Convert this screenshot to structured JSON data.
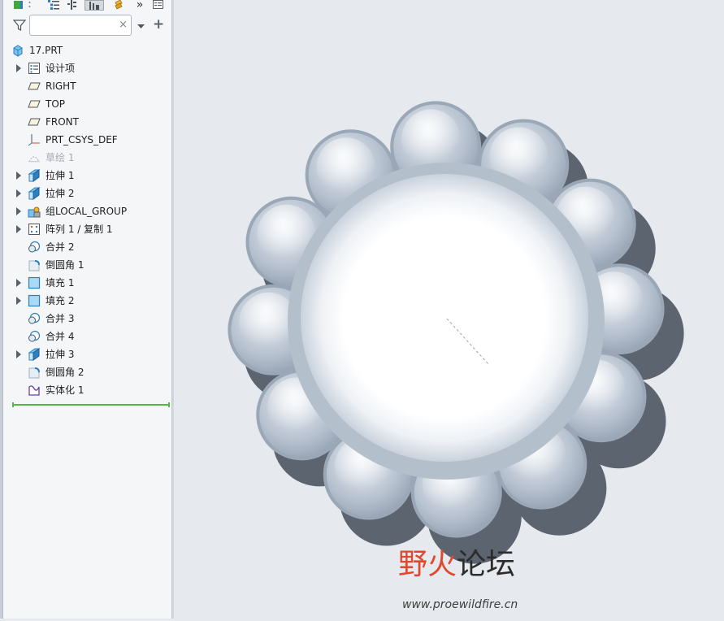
{
  "toolbar": {
    "icons": [
      "model-tree-icon",
      "tree-columns-icon",
      "tree-filters-icon",
      "show-icon",
      "layer-icon",
      "more-icon",
      "settings-icon"
    ],
    "more_label": "»"
  },
  "filter": {
    "value": "",
    "clear_glyph": "×",
    "add_glyph": "+"
  },
  "tree": {
    "root": {
      "label": "17.PRT",
      "icon": "part-icon"
    },
    "items": [
      {
        "label": "设计项",
        "icon": "design-items-icon",
        "expandable": true,
        "dimmed": false
      },
      {
        "label": "RIGHT",
        "icon": "datum-plane-icon",
        "expandable": false,
        "dimmed": false
      },
      {
        "label": "TOP",
        "icon": "datum-plane-icon",
        "expandable": false,
        "dimmed": false
      },
      {
        "label": "FRONT",
        "icon": "datum-plane-icon",
        "expandable": false,
        "dimmed": false
      },
      {
        "label": "PRT_CSYS_DEF",
        "icon": "csys-icon",
        "expandable": false,
        "dimmed": false
      },
      {
        "label": "草绘 1",
        "icon": "sketch-icon",
        "expandable": false,
        "dimmed": true
      },
      {
        "label": "拉伸 1",
        "icon": "extrude-icon",
        "expandable": true,
        "dimmed": false
      },
      {
        "label": "拉伸 2",
        "icon": "extrude-icon",
        "expandable": true,
        "dimmed": false
      },
      {
        "label": "组LOCAL_GROUP",
        "icon": "group-icon",
        "expandable": true,
        "dimmed": false
      },
      {
        "label": "阵列 1 / 复制 1",
        "icon": "pattern-icon",
        "expandable": true,
        "dimmed": false
      },
      {
        "label": "合并 2",
        "icon": "merge-icon",
        "expandable": false,
        "dimmed": false
      },
      {
        "label": "倒圆角 1",
        "icon": "round-icon",
        "expandable": false,
        "dimmed": false
      },
      {
        "label": "填充 1",
        "icon": "fill-icon",
        "expandable": true,
        "dimmed": false
      },
      {
        "label": "填充 2",
        "icon": "fill-icon",
        "expandable": true,
        "dimmed": false
      },
      {
        "label": "合并 3",
        "icon": "merge-icon",
        "expandable": false,
        "dimmed": false
      },
      {
        "label": "合并 4",
        "icon": "merge-icon",
        "expandable": false,
        "dimmed": false
      },
      {
        "label": "拉伸 3",
        "icon": "extrude-icon",
        "expandable": true,
        "dimmed": false
      },
      {
        "label": "倒圆角 2",
        "icon": "round-icon",
        "expandable": false,
        "dimmed": false
      },
      {
        "label": "实体化 1",
        "icon": "solidify-icon",
        "expandable": false,
        "dimmed": false
      }
    ]
  },
  "watermark": {
    "title_part1": "野火",
    "title_part2": "论坛",
    "url": "www.proewildfire.cn"
  },
  "colors": {
    "panel_bg": "#f4f6f8",
    "viewport_bg": "#e6e9ed",
    "model_steel": "#a6b3c3",
    "insert_marker": "#4cbc3c",
    "watermark_red": "#e0472b"
  }
}
